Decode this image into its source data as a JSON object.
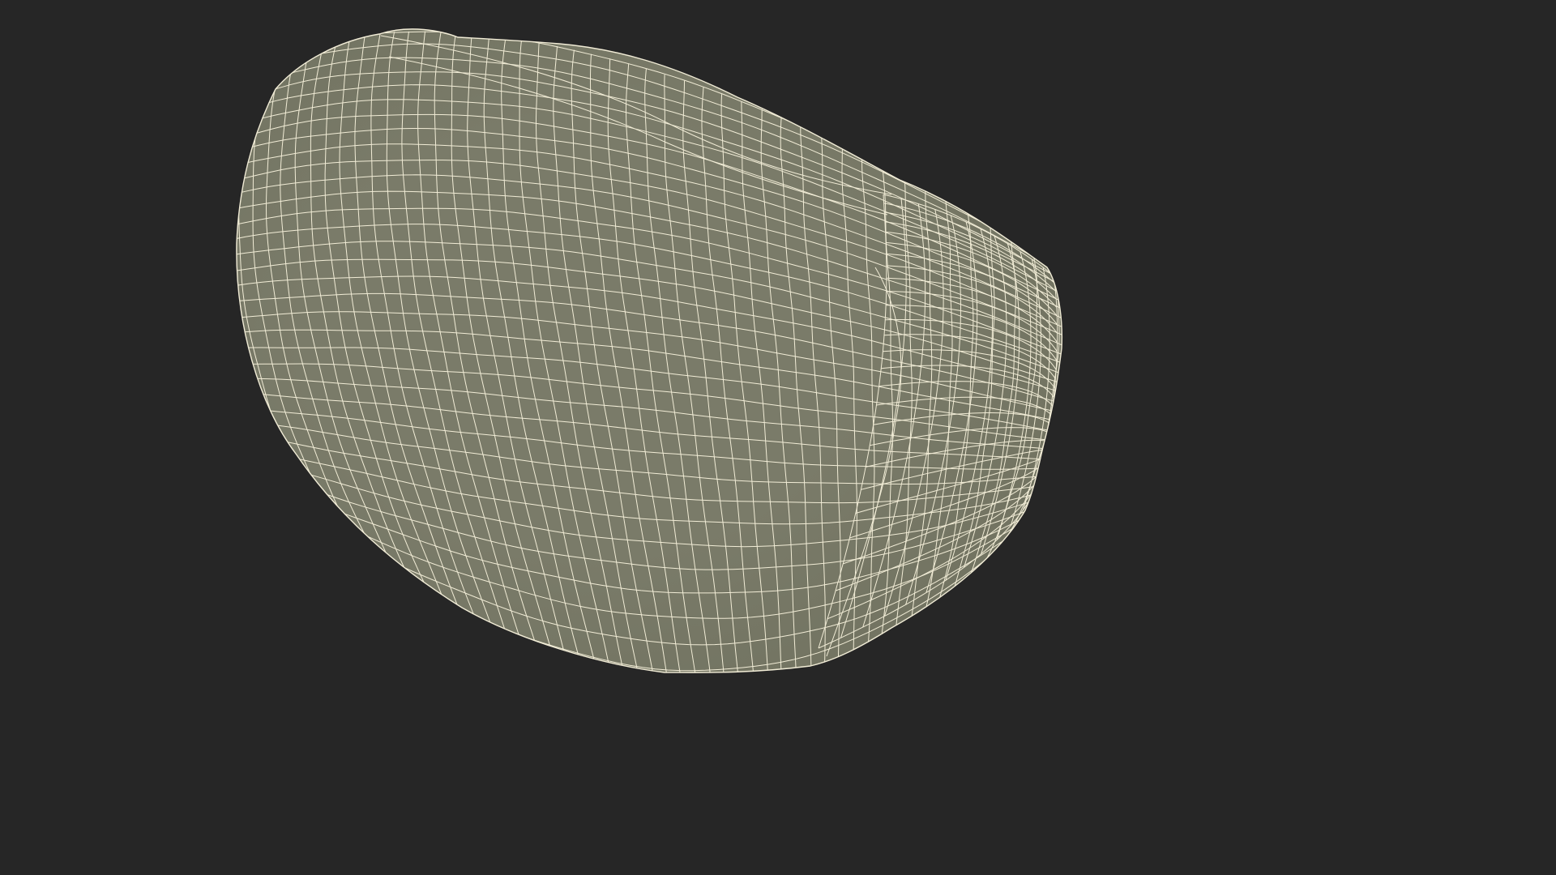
{
  "scene": {
    "background_color": "#262626",
    "mesh_fill_color": "#7a7b69",
    "wire_color": "#f1ecd6",
    "rim_shade_color": "#626452",
    "subject": "wireframe-mesh-model"
  }
}
